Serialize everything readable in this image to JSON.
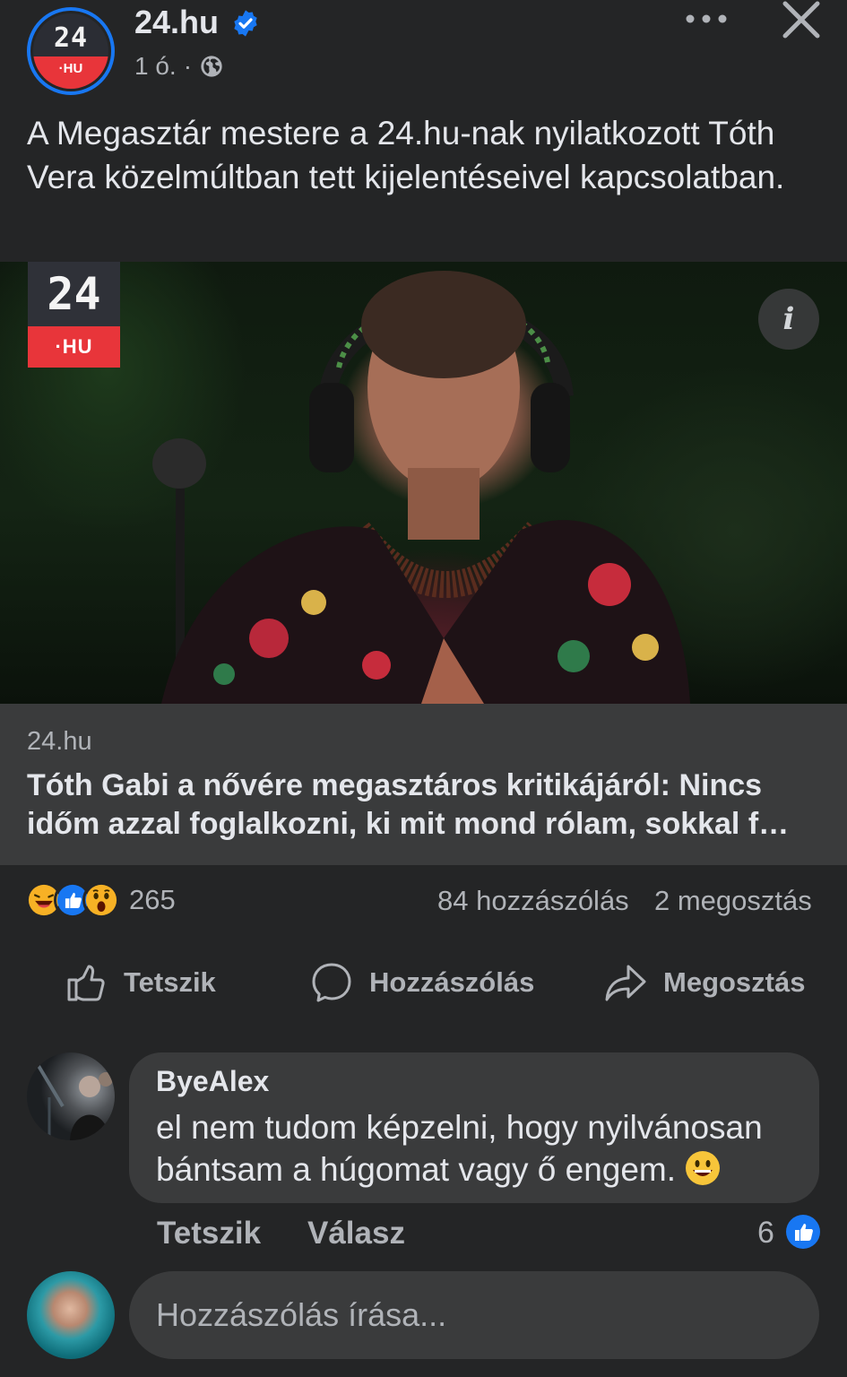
{
  "header": {
    "page_name": "24.hu",
    "avatar_logo_top": "24",
    "avatar_logo_bottom": "·HU",
    "time": "1 ó.",
    "separator": "·",
    "verified_icon": "verified-badge-icon",
    "privacy_icon": "globe-icon"
  },
  "post": {
    "text": "A Megasztár mestere a 24.hu-nak nyilatkozott Tóth Vera közelmúltban tett kijelentéseivel kapcsolatban."
  },
  "image": {
    "logo_top": "24",
    "logo_bottom": "·HU",
    "info_label": "i"
  },
  "link": {
    "domain": "24.hu",
    "title": "Tóth Gabi a nővére megasztáros kritikájáról: Nincs időm azzal foglalkozni, ki mit mond rólam, sokkal f…"
  },
  "stats": {
    "reaction_icons": [
      "haha-icon",
      "like-icon",
      "wow-icon"
    ],
    "reactions": "265",
    "comments": "84 hozzászólás",
    "shares": "2 megosztás"
  },
  "actions": {
    "like": "Tetszik",
    "comment": "Hozzászólás",
    "share": "Megosztás"
  },
  "comment": {
    "author": "ByeAlex",
    "text": "el nem tudom képzelni, hogy nyilvánosan bántsam a húgomat vagy ő engem.",
    "like": "Tetszik",
    "reply": "Válasz",
    "reaction_count": "6"
  },
  "composer": {
    "placeholder": "Hozzászólás írása..."
  },
  "colors": {
    "background": "#242526",
    "surface": "#3a3b3c",
    "text_primary": "#e4e6eb",
    "text_secondary": "#b0b3b8",
    "brand_blue": "#1877f2",
    "brand_red": "#e8353a"
  }
}
